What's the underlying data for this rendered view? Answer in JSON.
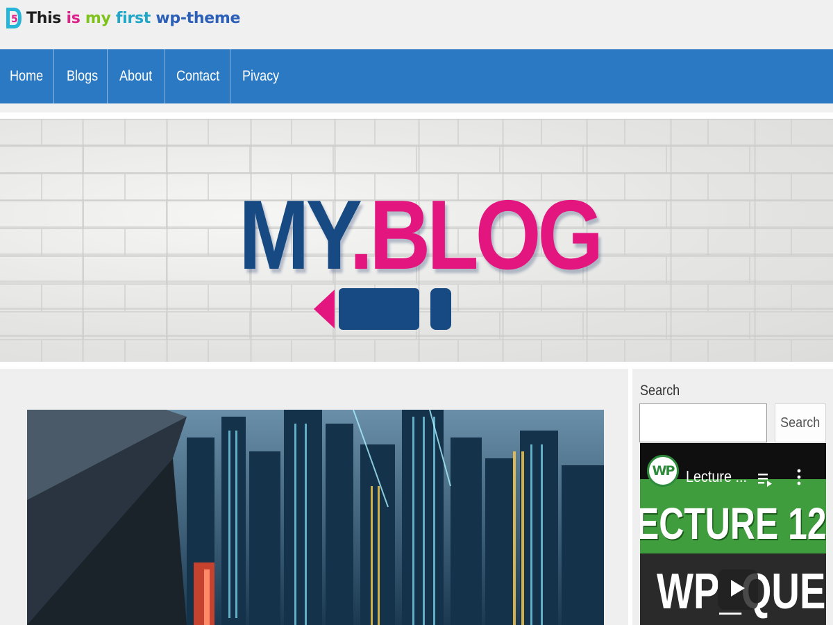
{
  "site": {
    "title_words": [
      {
        "text": "This",
        "color": "#1d1d1d"
      },
      {
        "text": " is",
        "color": "#e0208a"
      },
      {
        "text": " my",
        "color": "#7fc21b"
      },
      {
        "text": " first",
        "color": "#1fa6c8"
      },
      {
        "text": " wp-theme",
        "color": "#2b5fb8"
      }
    ],
    "logo_icon": "d5-logo-icon"
  },
  "nav": {
    "items": [
      {
        "label": "Home"
      },
      {
        "label": "Blogs"
      },
      {
        "label": "About"
      },
      {
        "label": "Contact"
      },
      {
        "label": "Pivacy"
      }
    ],
    "background": "#2b79c2"
  },
  "banner": {
    "logo_part1": "MY",
    "logo_part2": ".BLOG",
    "logo_colors": {
      "primary": "#174a82",
      "accent": "#e3157f"
    },
    "pencil_icon": "pencil-icon"
  },
  "sidebar": {
    "search": {
      "label": "Search",
      "placeholder": "",
      "value": "",
      "button_label": "Search"
    },
    "video": {
      "channel_badge": "WP",
      "title": "Lecture ...",
      "thumbnail_line1": "ECTURE 12",
      "thumbnail_line2": "WP_QUERY",
      "icons": [
        "playlist-icon",
        "more-vert-icon",
        "play-icon"
      ]
    }
  },
  "main": {
    "featured_image": "city-night-skyline-image"
  }
}
